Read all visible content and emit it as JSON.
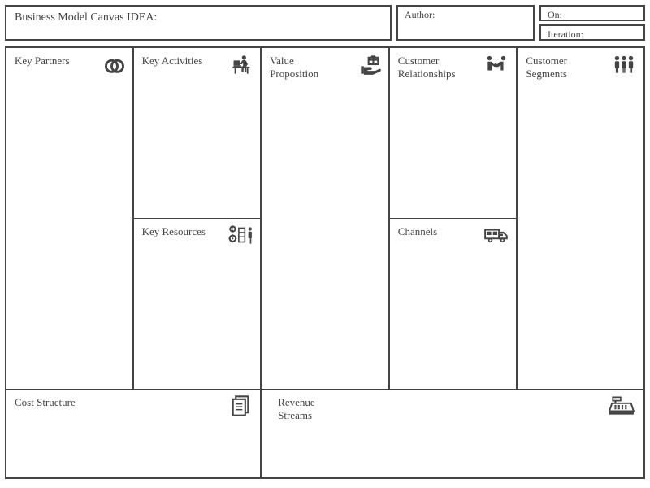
{
  "header": {
    "idea_label": "Business Model Canvas IDEA:",
    "author_label": "Author:",
    "on_label": "On:",
    "iteration_label": "Iteration:"
  },
  "blocks": {
    "key_partners": {
      "title": "Key Partners"
    },
    "key_activities": {
      "title": "Key Activities"
    },
    "key_resources": {
      "title": "Key Resources"
    },
    "value_proposition": {
      "title": "Value Proposition"
    },
    "customer_relationships": {
      "title": "Customer Relationships"
    },
    "channels": {
      "title": "Channels"
    },
    "customer_segments": {
      "title": "Customer Segments"
    },
    "cost_structure": {
      "title": "Cost Structure"
    },
    "revenue_streams": {
      "title": "Revenue Streams"
    }
  }
}
